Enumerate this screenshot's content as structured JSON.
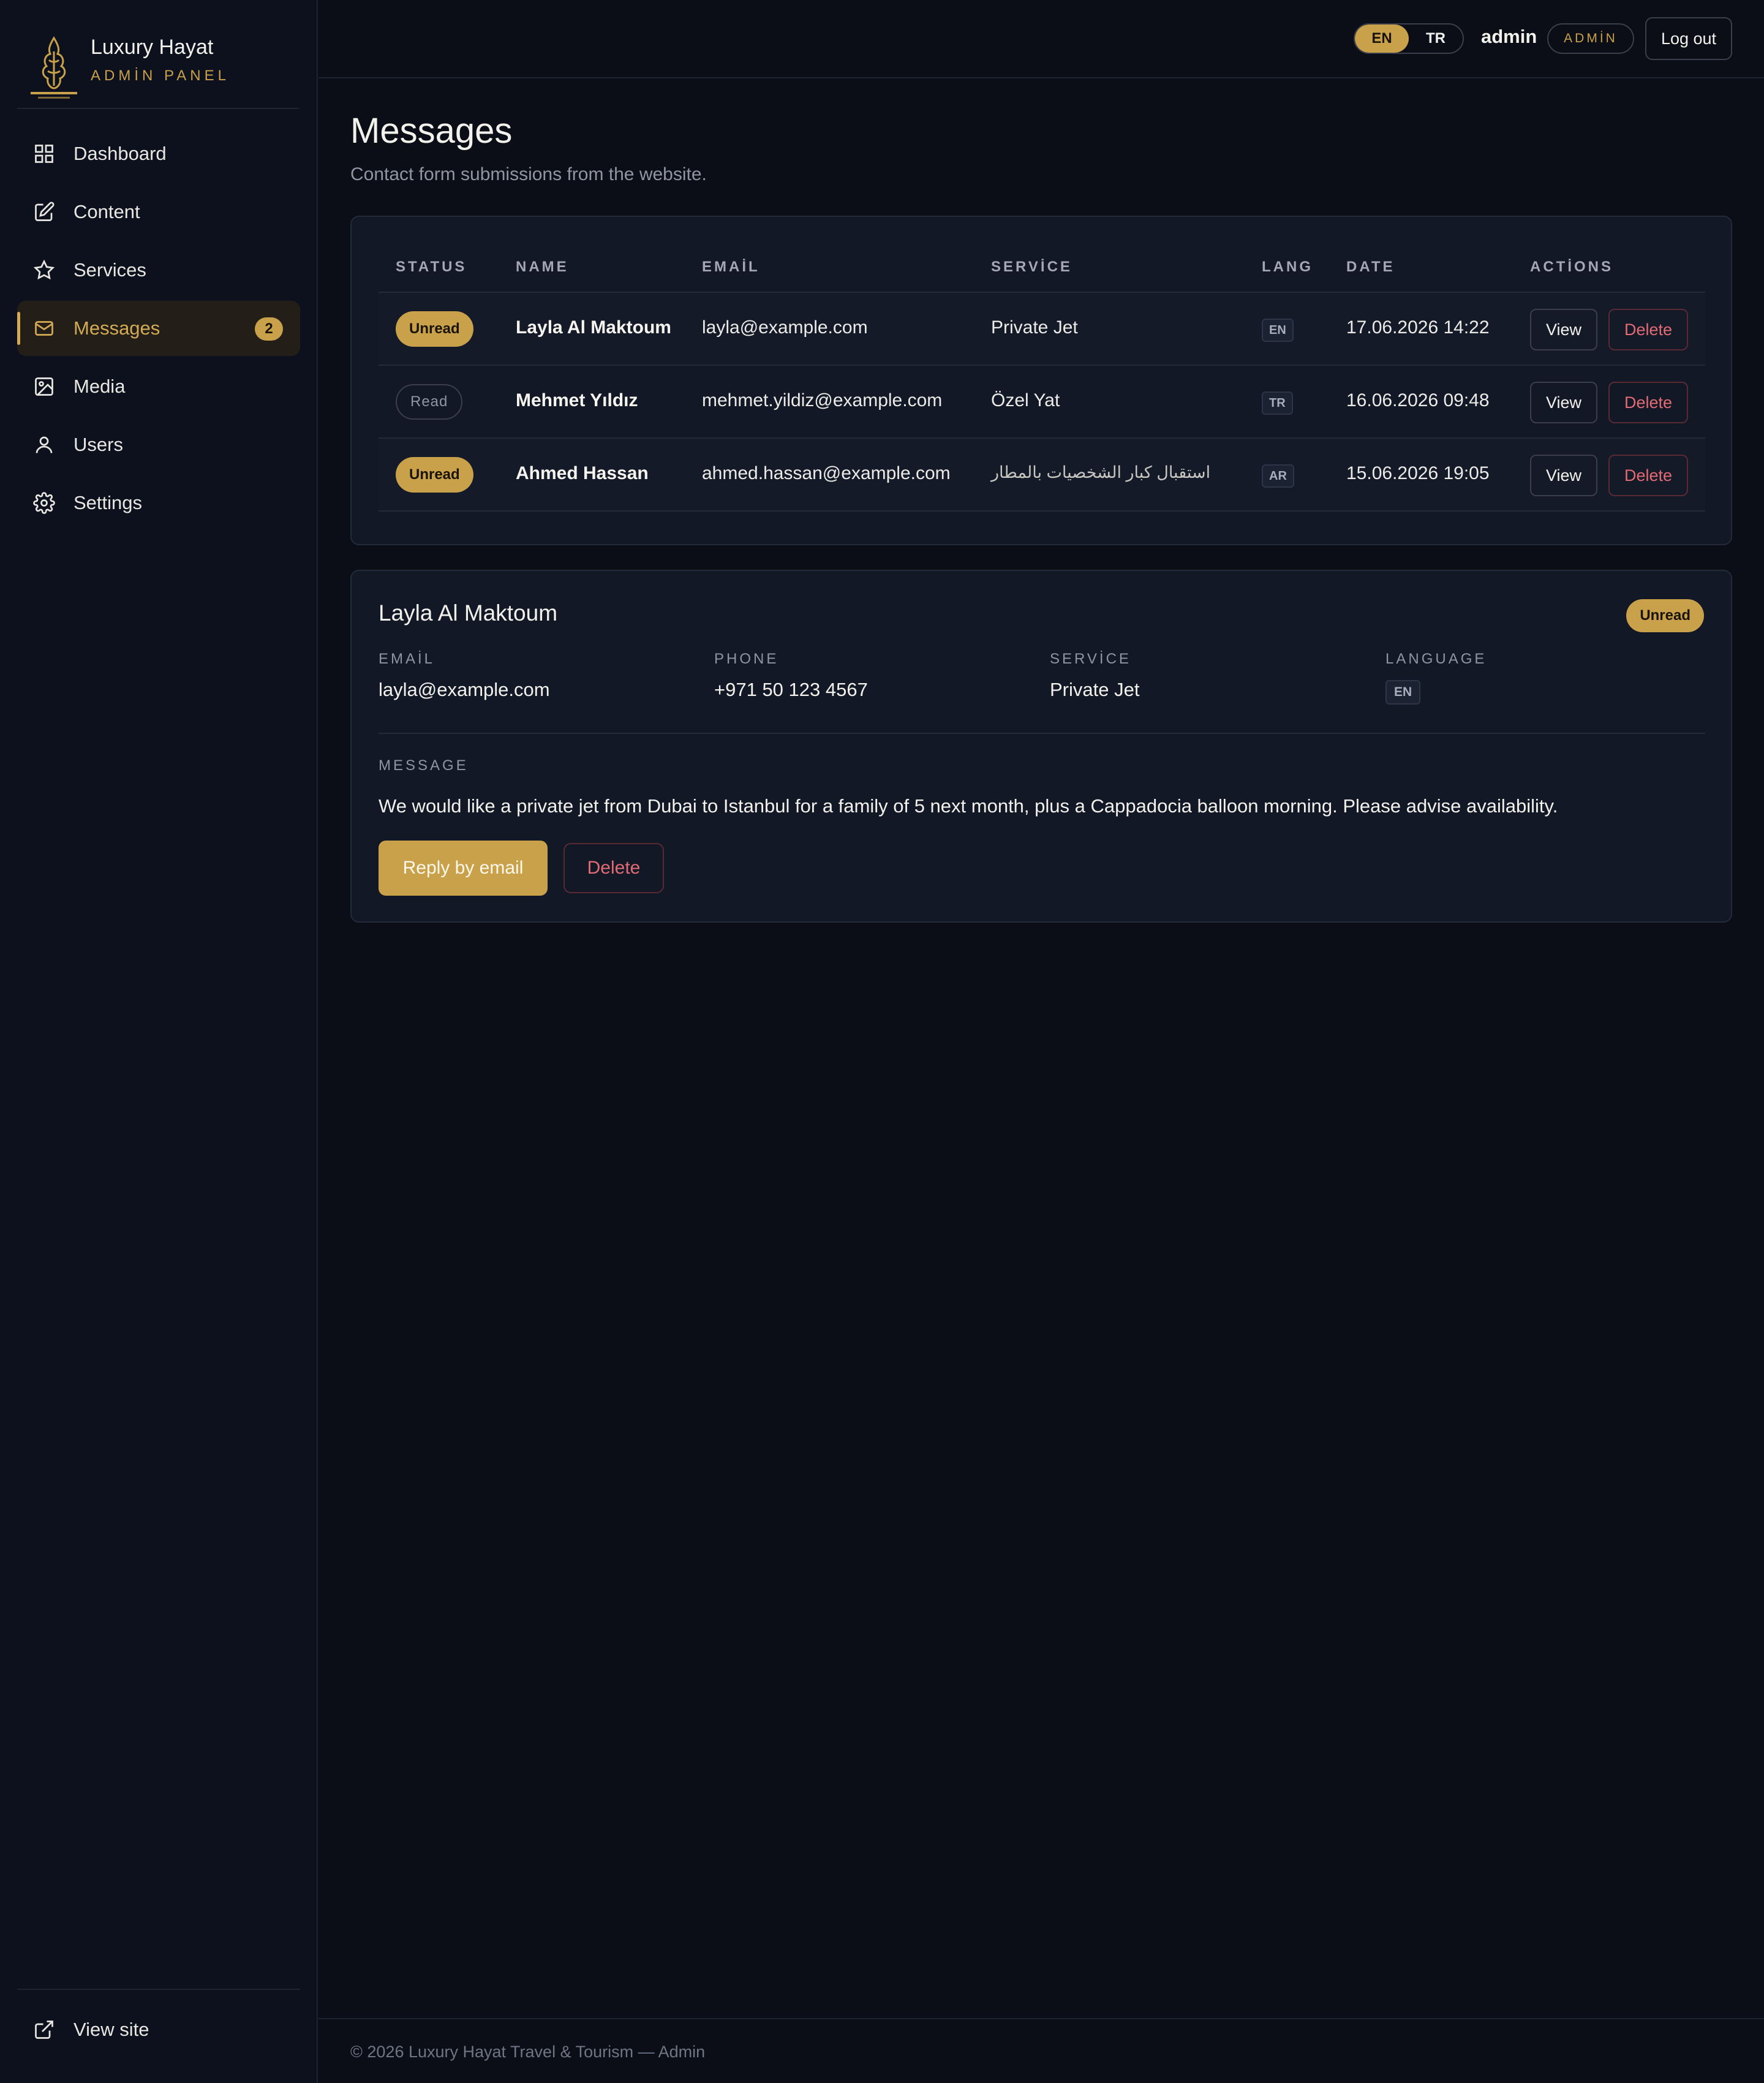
{
  "brand": {
    "name": "Luxury Hayat",
    "subtitle": "ADMİN PANEL",
    "logo_text": "LUXURY HAYAT"
  },
  "sidebar": {
    "items": [
      {
        "label": "Dashboard",
        "icon": "grid-icon"
      },
      {
        "label": "Content",
        "icon": "edit-icon"
      },
      {
        "label": "Services",
        "icon": "star-icon"
      },
      {
        "label": "Messages",
        "icon": "mail-icon",
        "badge": "2",
        "active": true
      },
      {
        "label": "Media",
        "icon": "image-icon"
      },
      {
        "label": "Users",
        "icon": "user-icon"
      },
      {
        "label": "Settings",
        "icon": "gear-icon"
      }
    ],
    "view_site": "View site"
  },
  "topbar": {
    "lang_en": "EN",
    "lang_tr": "TR",
    "user": "admin",
    "role": "ADMİN",
    "logout": "Log out"
  },
  "page": {
    "title": "Messages",
    "subtitle": "Contact form submissions from the website."
  },
  "table": {
    "headers": [
      "STATUS",
      "NAME",
      "EMAİL",
      "SERVİCE",
      "LANG",
      "DATE",
      "ACTİONS"
    ],
    "rows": [
      {
        "status": "Unread",
        "name": "Layla Al Maktoum",
        "email": "layla@example.com",
        "service": "Private Jet",
        "lang": "EN",
        "date": "17.06.2026 14:22",
        "view": "View",
        "delete": "Delete"
      },
      {
        "status": "Read",
        "name": "Mehmet Yıldız",
        "email": "mehmet.yildiz@example.com",
        "service": "Özel Yat",
        "lang": "TR",
        "date": "16.06.2026 09:48",
        "view": "View",
        "delete": "Delete"
      },
      {
        "status": "Unread",
        "name": "Ahmed Hassan",
        "email": "ahmed.hassan@example.com",
        "service": "استقبال كبار الشخصيات بالمطار",
        "lang": "AR",
        "date": "15.06.2026 19:05",
        "view": "View",
        "delete": "Delete"
      }
    ]
  },
  "detail": {
    "name": "Layla Al Maktoum",
    "status": "Unread",
    "email_label": "EMAİL",
    "email": "layla@example.com",
    "phone_label": "PHONE",
    "phone": "+971 50 123 4567",
    "service_label": "SERVİCE",
    "service": "Private Jet",
    "language_label": "LANGUAGE",
    "language": "EN",
    "message_label": "MESSAGE",
    "message": "We would like a private jet from Dubai to Istanbul for a family of 5 next month, plus a Cappadocia balloon morning. Please advise availability.",
    "reply": "Reply by email",
    "delete": "Delete"
  },
  "footer": {
    "text": "© 2026 Luxury Hayat Travel & Tourism — Admin"
  },
  "colors": {
    "accent": "#c9a14a",
    "background": "#0b0e16",
    "card": "#121826",
    "danger": "#e26b74"
  }
}
